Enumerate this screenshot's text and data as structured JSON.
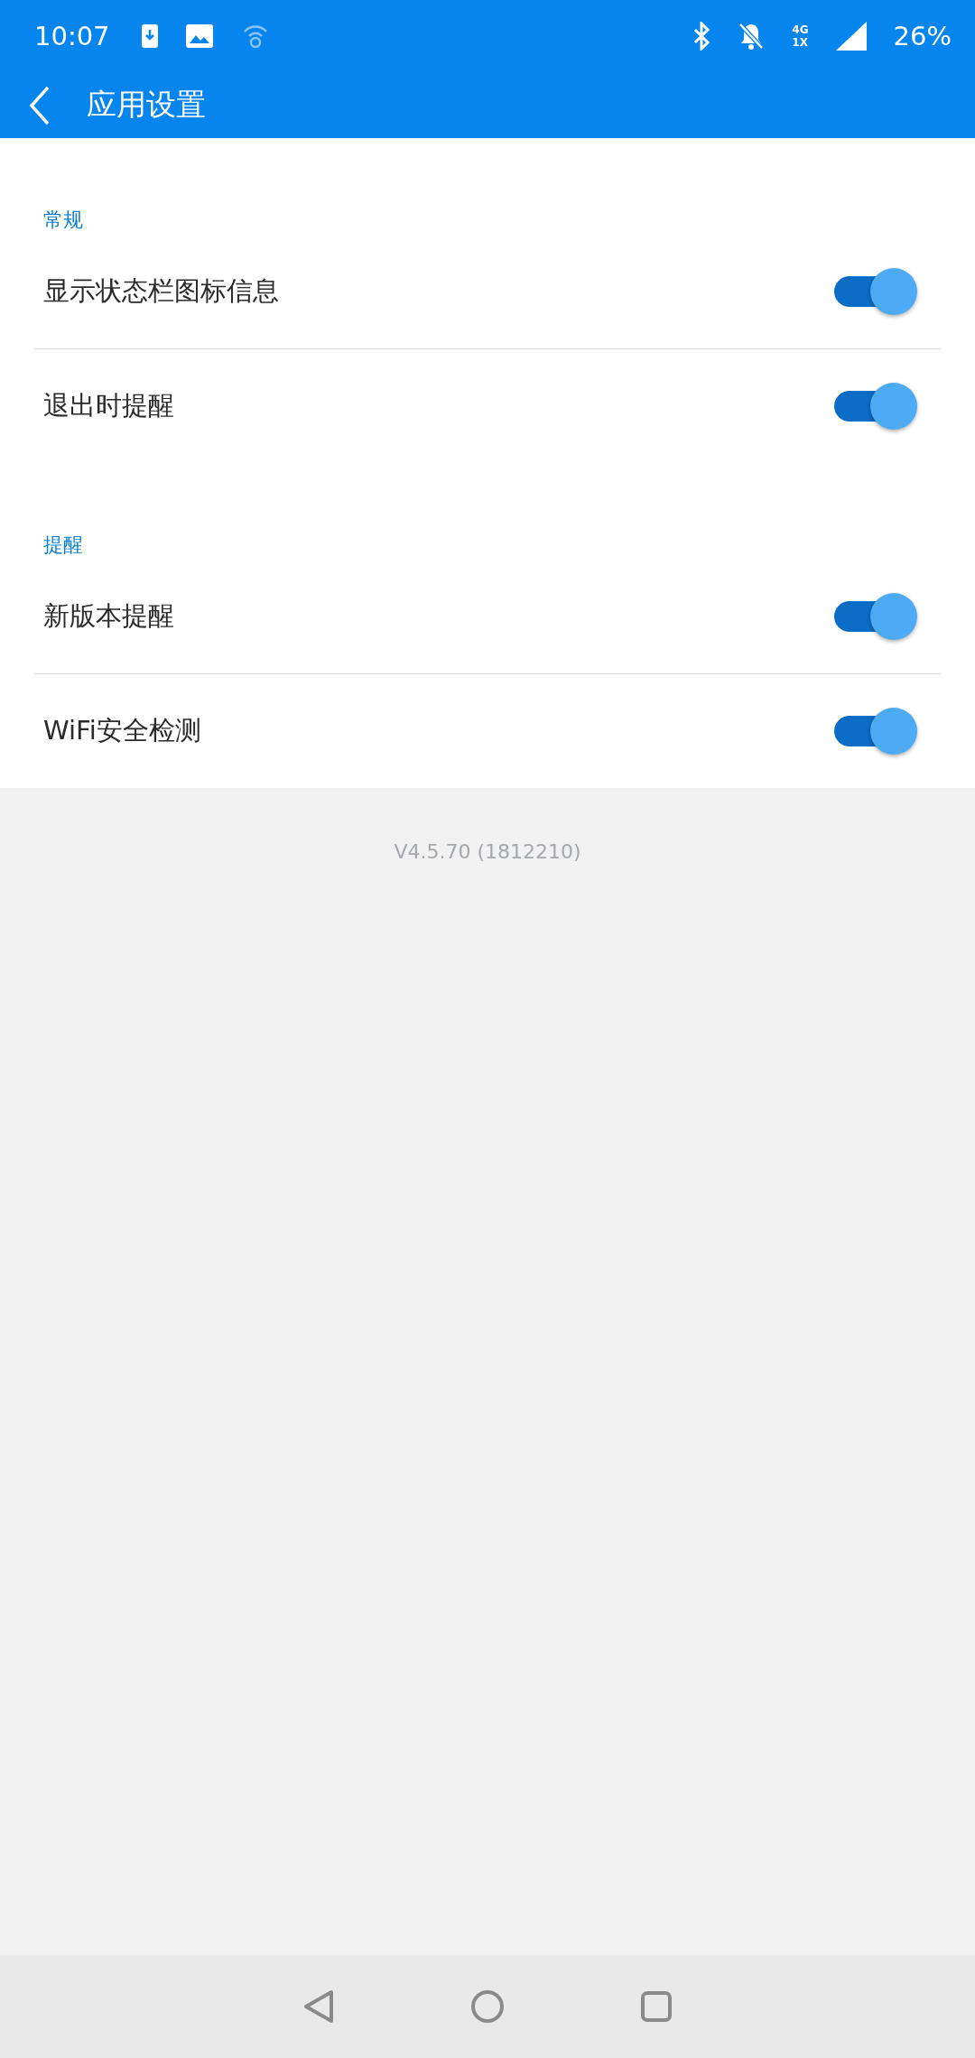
{
  "status_bar": {
    "time": "10:07",
    "network_top": "4G",
    "network_bottom": "1X",
    "battery": "26%"
  },
  "app_bar": {
    "title": "应用设置"
  },
  "sections": [
    {
      "header": "常规",
      "items": [
        {
          "label": "显示状态栏图标信息",
          "on": true
        },
        {
          "label": "退出时提醒",
          "on": true
        }
      ]
    },
    {
      "header": "提醒",
      "items": [
        {
          "label": "新版本提醒",
          "on": true
        },
        {
          "label": "WiFi安全检测",
          "on": true
        }
      ]
    }
  ],
  "version": "V4.5.70 (1812210)"
}
